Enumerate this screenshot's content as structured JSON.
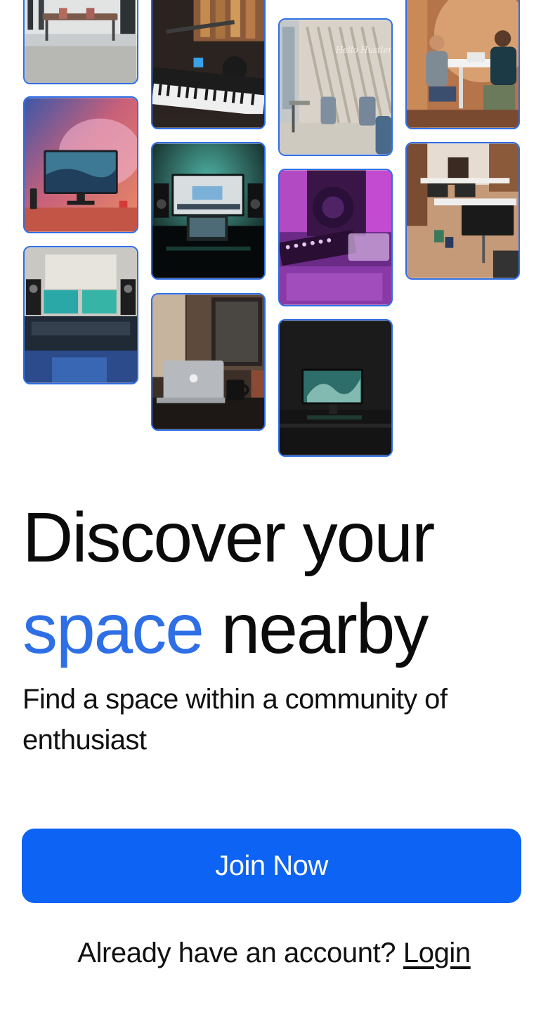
{
  "hero": {
    "title_line1": "Discover your",
    "title_accent": "space",
    "title_rest": "nearby",
    "subtitle": "Find a space within a community of enthusiast"
  },
  "cta": {
    "join_label": "Join Now"
  },
  "login": {
    "prompt": "Already have an account?",
    "link_label": "Login"
  },
  "colors": {
    "accent": "#2e6fe6",
    "button": "#0d63f3",
    "tile_border": "#2f6ee6"
  },
  "gallery": {
    "tiles": [
      "office-meeting-room-photo",
      "music-studio-keyboard-photo",
      "cafe-hello-sign-photo",
      "coworking-conversation-photo",
      "neon-desk-setup-photo",
      "editing-desk-monitor-photo",
      "purple-dj-mixer-photo",
      "open-office-desks-photo",
      "recording-studio-console-photo",
      "laptop-desk-photo",
      "dark-monitor-desk-photo"
    ],
    "cafe_sign_text": "Hello Hustler"
  }
}
